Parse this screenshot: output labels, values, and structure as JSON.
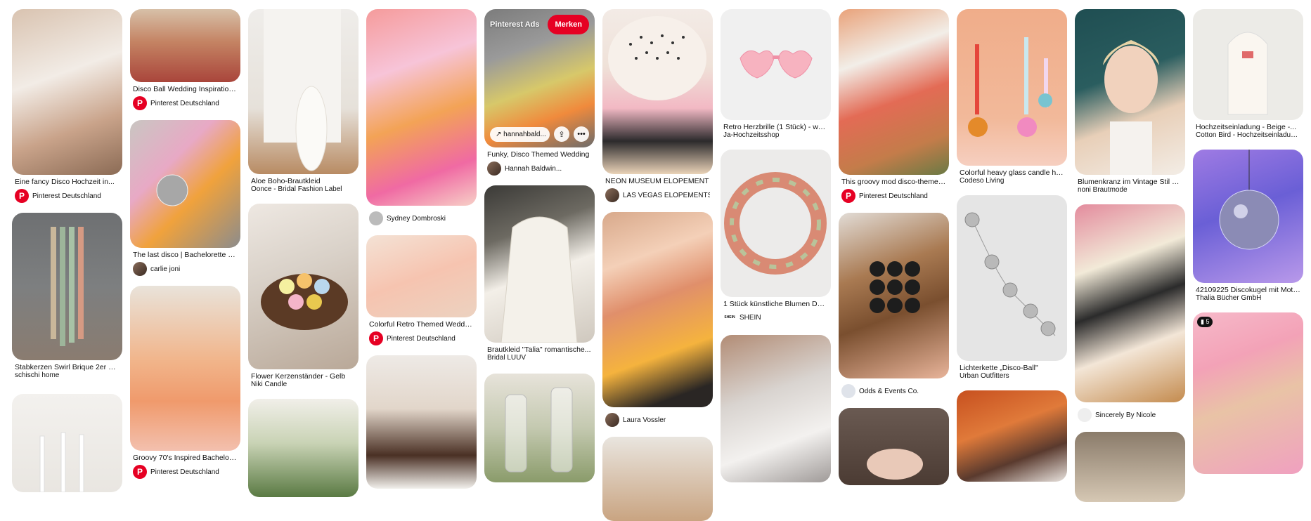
{
  "brand_color": "#e60023",
  "ad_overlay": {
    "label": "Pinterest Ads",
    "save_label": "Merken",
    "link_text": "hannahbald...",
    "share_icon": "share-icon",
    "more_icon": "ellipsis-icon"
  },
  "pins": {
    "c1p1": {
      "title": "Eine fancy Disco Hochzeit in...",
      "author": "Pinterest Deutschland"
    },
    "c1p2": {
      "title": "Stabkerzen Swirl Brique 2er Set,...",
      "sub": "schischi home"
    },
    "c2p1": {
      "title": "Disco Ball Wedding Inspiration in...",
      "author": "Pinterest Deutschland"
    },
    "c2p2": {
      "title": "The last disco | Bachelorette party",
      "author": "carlie joni"
    },
    "c2p3": {
      "title": "Groovy 70's Inspired Bachelorett...",
      "author": "Pinterest Deutschland"
    },
    "c3p1": {
      "title": "Aloe Boho-Brautkleid",
      "sub": "Oonce - Bridal Fashion Label"
    },
    "c3p2": {
      "title": "Flower Kerzenständer - Gelb",
      "sub": "Niki Candle"
    },
    "c4p1": {
      "author": "Sydney Dombroski"
    },
    "c4p2": {
      "title": "Colorful Retro Themed Wedding...",
      "author": "Pinterest Deutschland"
    },
    "c5p1": {
      "title": "Funky, Disco Themed Wedding",
      "author": "Hannah Baldwin..."
    },
    "c5p2": {
      "title": "Brautkleid \"Talia\" romantische...",
      "sub": "Bridal LUUV"
    },
    "c6p1": {
      "title": "NEON MUSEUM ELOPEMENT",
      "author": "LAS VEGAS ELOPEMENTS |..."
    },
    "c6p2": {
      "author": "Laura Vossler"
    },
    "c7p1": {
      "title": "Retro Herzbrille (1 Stück) - weiß",
      "sub": "Ja-Hochzeitsshop"
    },
    "c7p2": {
      "title": "1 Stück künstliche Blumen Dekor...",
      "author": "SHEIN",
      "avatar_text": "SHEIN"
    },
    "c8p1": {
      "title": "This groovy mod disco-themed...",
      "author": "Pinterest Deutschland"
    },
    "c8p2": {
      "author": "Odds & Events Co."
    },
    "c9p1": {
      "title": "Colorful heavy glass candle holder",
      "sub": "Codeso Living"
    },
    "c9p2": {
      "title": "Lichterkette „Disco-Ball\"",
      "sub": "Urban Outfitters"
    },
    "c10p1": {
      "title": "Blumenkranz im Vintage Stil mit...",
      "sub": "noni Brautmode"
    },
    "c10p2": {
      "author": "Sincerely By Nicole"
    },
    "c11p1": {
      "title": "Hochzeitseinladung - Beige -...",
      "sub": "Cotton Bird - Hochzeitseinladunge..."
    },
    "c11p2": {
      "title": "42109225 Discokugel mit Motor...",
      "sub": "Thalia Bücher GmbH"
    },
    "c11p3": {
      "badge": "5"
    }
  }
}
